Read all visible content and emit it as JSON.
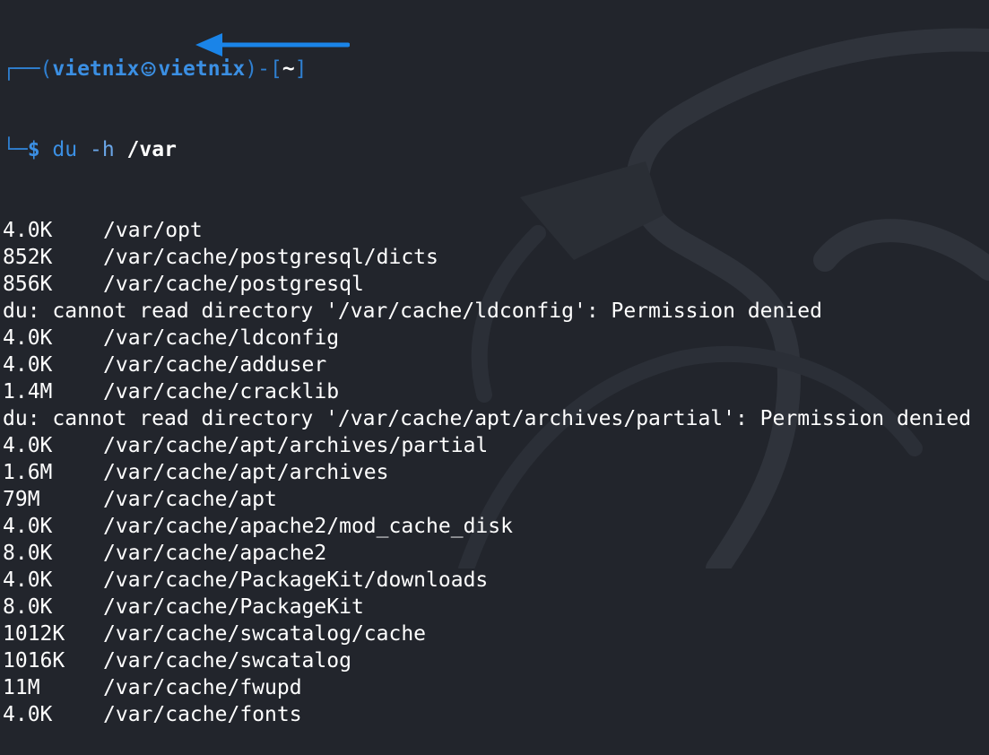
{
  "colors": {
    "background": "#22252c",
    "prompt_blue": "#3b8fe3",
    "text": "#ffffff",
    "arrow": "#1a84e8"
  },
  "prompt": {
    "frame_top": "┌──(",
    "user": "vietnix",
    "separator_icon": "kali-skull-icon",
    "host": "vietnix",
    "frame_mid": ")-[",
    "path": "~",
    "frame_end": "]",
    "frame_bottom": "└─",
    "dollar": "$",
    "command": "du",
    "flag": "-h",
    "argument": "/var"
  },
  "annotation": {
    "arrow_icon": "left-arrow-icon"
  },
  "output": [
    {
      "size": "4.0K",
      "path": "/var/opt"
    },
    {
      "size": "852K",
      "path": "/var/cache/postgresql/dicts"
    },
    {
      "size": "856K",
      "path": "/var/cache/postgresql"
    },
    {
      "message": "du: cannot read directory '/var/cache/ldconfig': Permission denied"
    },
    {
      "size": "4.0K",
      "path": "/var/cache/ldconfig"
    },
    {
      "size": "4.0K",
      "path": "/var/cache/adduser"
    },
    {
      "size": "1.4M",
      "path": "/var/cache/cracklib"
    },
    {
      "message": "du: cannot read directory '/var/cache/apt/archives/partial': Permission denied"
    },
    {
      "size": "4.0K",
      "path": "/var/cache/apt/archives/partial"
    },
    {
      "size": "1.6M",
      "path": "/var/cache/apt/archives"
    },
    {
      "size": "79M",
      "path": "/var/cache/apt"
    },
    {
      "size": "4.0K",
      "path": "/var/cache/apache2/mod_cache_disk"
    },
    {
      "size": "8.0K",
      "path": "/var/cache/apache2"
    },
    {
      "size": "4.0K",
      "path": "/var/cache/PackageKit/downloads"
    },
    {
      "size": "8.0K",
      "path": "/var/cache/PackageKit"
    },
    {
      "size": "1012K",
      "path": "/var/cache/swcatalog/cache"
    },
    {
      "size": "1016K",
      "path": "/var/cache/swcatalog"
    },
    {
      "size": "11M",
      "path": "/var/cache/fwupd"
    },
    {
      "size": "4.0K",
      "path": "/var/cache/fonts"
    }
  ]
}
